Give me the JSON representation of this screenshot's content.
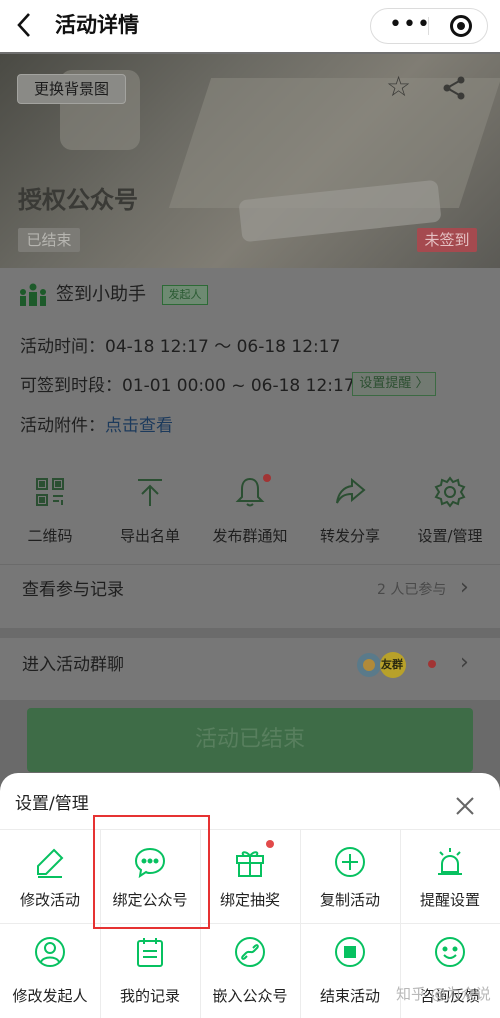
{
  "nav": {
    "back_icon": "chevron-left-icon",
    "title": "活动详情",
    "more_icon": "more-dots-icon",
    "close_icon": "target-icon"
  },
  "banner": {
    "change_bg_label": "更换背景图",
    "activity_title": "授权公众号",
    "status_ended": "已结束",
    "status_unsigned": "未签到",
    "icons": [
      "star-icon",
      "share-icon"
    ]
  },
  "helper": {
    "name": "签到小助手",
    "creator_tag": "发起人"
  },
  "info": {
    "time_label": "活动时间：",
    "time_value": "04-18 12:17 ～ 06-18 12:17",
    "sign_label": "可签到时段：",
    "sign_value": "01-01 00:00 ~ 06-18 12:17",
    "remind_btn": "设置提醒 〉",
    "attach_label": "活动附件：",
    "attach_link": "点击查看"
  },
  "actions": [
    {
      "label": "二维码",
      "icon": "qrcode-icon"
    },
    {
      "label": "导出名单",
      "icon": "export-icon"
    },
    {
      "label": "发布群通知",
      "icon": "bell-icon"
    },
    {
      "label": "转发分享",
      "icon": "forward-icon"
    },
    {
      "label": "设置/管理",
      "icon": "gear-icon"
    }
  ],
  "records": {
    "label": "查看参与记录",
    "count": "2 人已参与"
  },
  "group": {
    "label": "进入活动群聊",
    "avatar_text": "友群"
  },
  "end_button": "活动已结束",
  "sheet": {
    "title": "设置/管理",
    "items": [
      {
        "label": "修改活动",
        "icon": "edit-icon"
      },
      {
        "label": "绑定公众号",
        "icon": "chat-bubble-icon"
      },
      {
        "label": "绑定抽奖",
        "icon": "gift-icon"
      },
      {
        "label": "复制活动",
        "icon": "plus-circle-icon"
      },
      {
        "label": "提醒设置",
        "icon": "alarm-icon"
      },
      {
        "label": "修改发起人",
        "icon": "user-icon"
      },
      {
        "label": "我的记录",
        "icon": "calendar-icon"
      },
      {
        "label": "嵌入公众号",
        "icon": "link-icon"
      },
      {
        "label": "结束活动",
        "icon": "stop-icon"
      },
      {
        "label": "咨询反馈",
        "icon": "smile-icon"
      }
    ]
  },
  "watermark": "知乎 @为众说",
  "colors": {
    "accent": "#07c160",
    "highlight": "#e63232",
    "badge_red": "#e24a4a"
  }
}
